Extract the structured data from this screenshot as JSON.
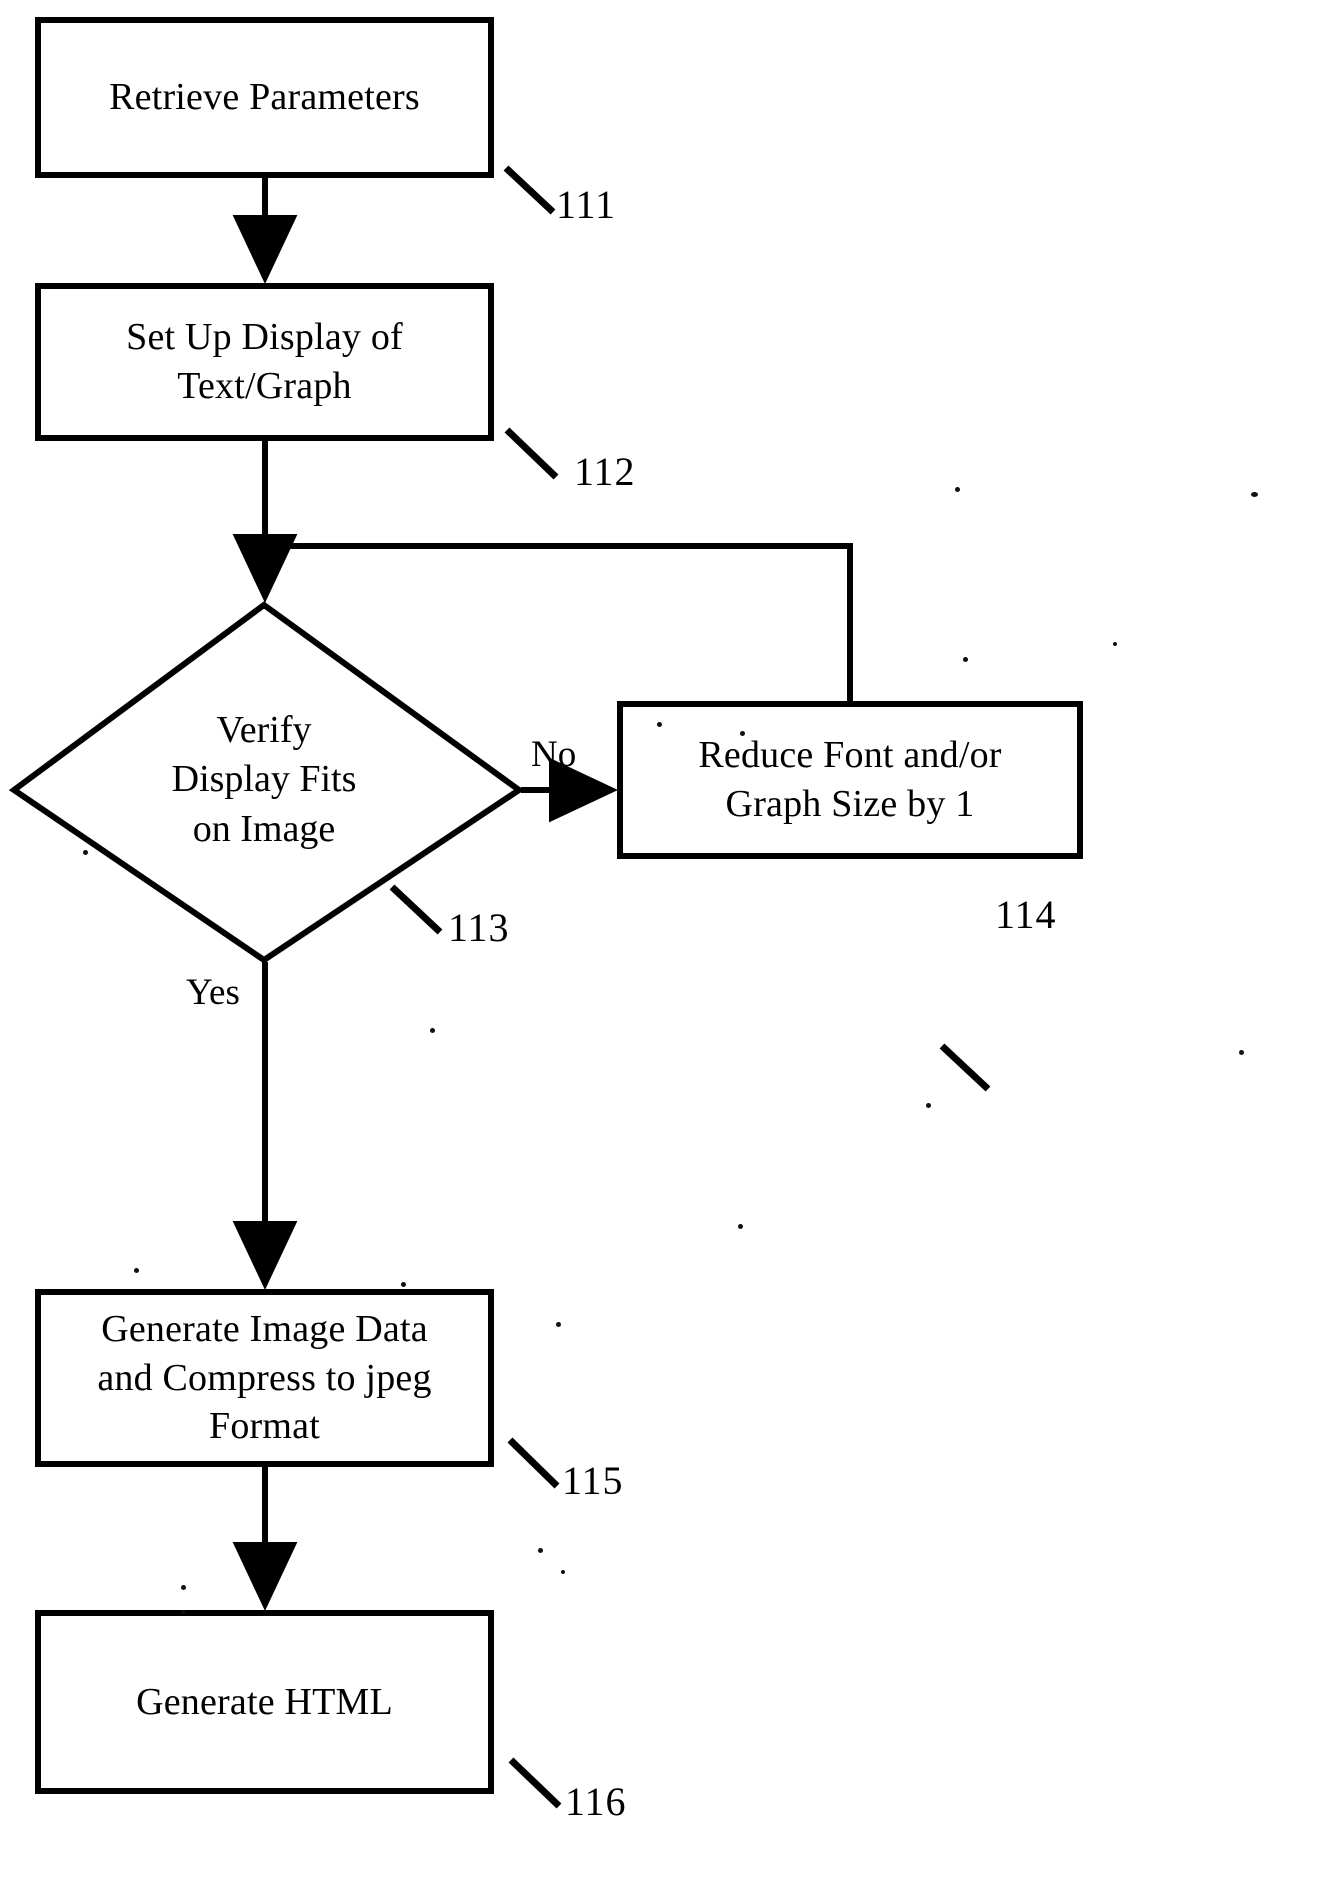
{
  "diagram": {
    "type": "flowchart",
    "title": "",
    "nodes": [
      {
        "id": "111",
        "shape": "process",
        "label": "Retrieve Parameters",
        "ref": "111"
      },
      {
        "id": "112",
        "shape": "process",
        "label": "Set Up Display of\nText/Graph",
        "ref": "112"
      },
      {
        "id": "113",
        "shape": "decision",
        "label": "Verify\nDisplay Fits\non Image",
        "ref": "113"
      },
      {
        "id": "114",
        "shape": "process",
        "label": "Reduce Font and/or\nGraph Size by 1",
        "ref": "114"
      },
      {
        "id": "115",
        "shape": "process",
        "label": "Generate Image Data\nand Compress to jpeg\nFormat",
        "ref": "115"
      },
      {
        "id": "116",
        "shape": "process",
        "label": "Generate HTML",
        "ref": "116"
      }
    ],
    "edges": [
      {
        "from": "111",
        "to": "112",
        "label": ""
      },
      {
        "from": "112",
        "to": "113",
        "label": ""
      },
      {
        "from": "113",
        "to": "114",
        "label": "No"
      },
      {
        "from": "114",
        "to": "112",
        "label": ""
      },
      {
        "from": "113",
        "to": "115",
        "label": "Yes"
      },
      {
        "from": "115",
        "to": "116",
        "label": ""
      }
    ],
    "edge_labels": {
      "no": "No",
      "yes": "Yes"
    },
    "ref_numbers": {
      "n111": "111",
      "n112": "112",
      "n113": "113",
      "n114": "114",
      "n115": "115",
      "n116": "116"
    },
    "colors": {
      "stroke": "#000000",
      "background": "#ffffff",
      "text": "#000000"
    }
  }
}
